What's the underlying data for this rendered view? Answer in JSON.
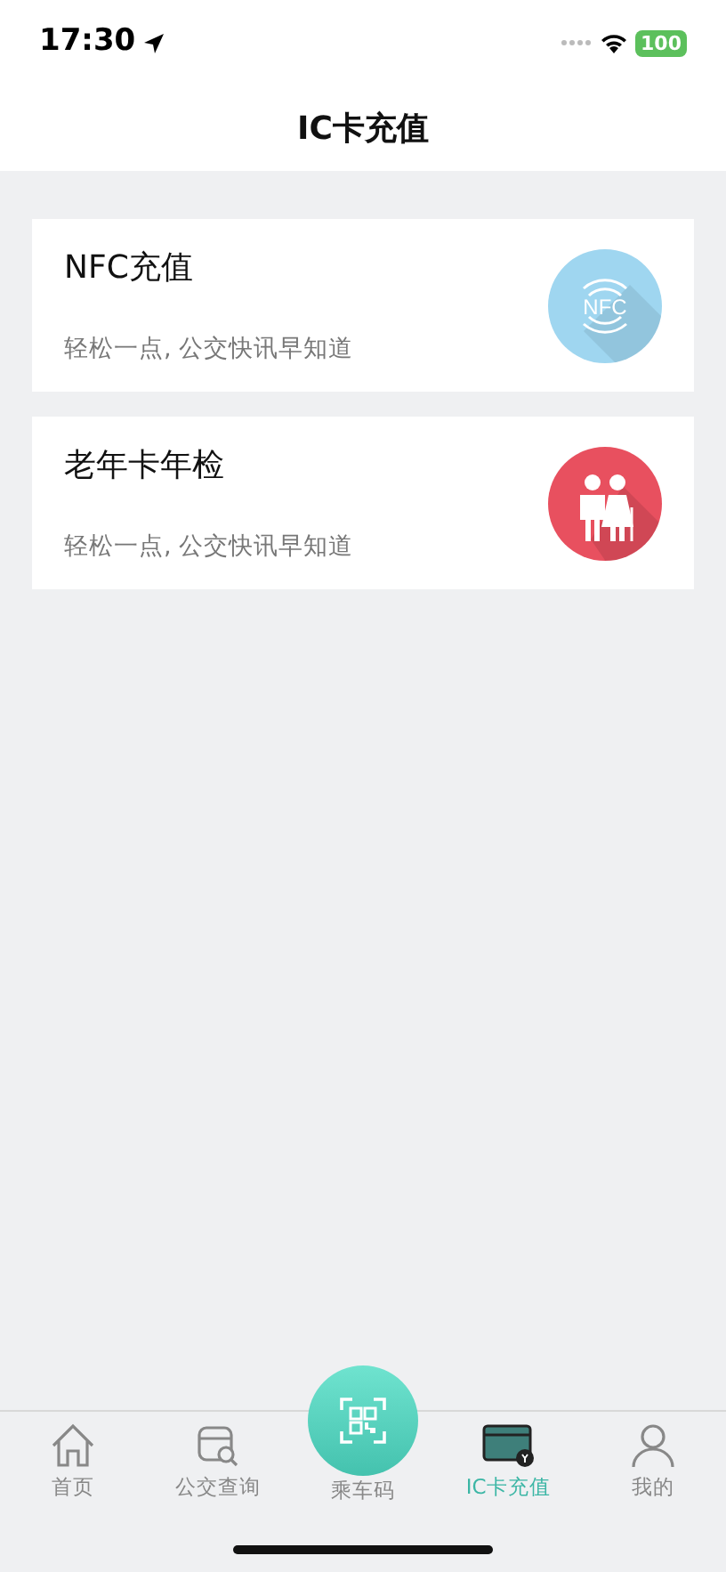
{
  "status_bar": {
    "time": "17:30",
    "battery": "100"
  },
  "header": {
    "title": "IC卡充值"
  },
  "cards": [
    {
      "kind": "nfc",
      "title": "NFC充值",
      "subtitle": "轻松一点, 公交快讯早知道",
      "color": "#9fd6f0",
      "icon_text": "NFC"
    },
    {
      "kind": "seniors",
      "title": "老年卡年检",
      "subtitle": "轻松一点, 公交快讯早知道",
      "color": "#e8505f"
    }
  ],
  "tab_bar": [
    {
      "kind": "plain",
      "label": "首页",
      "selected": false
    },
    {
      "kind": "plain",
      "label": "公交查询",
      "selected": false
    },
    {
      "kind": "raised",
      "label": "乘车码",
      "selected": false
    },
    {
      "kind": "plain",
      "label": "IC卡充值",
      "selected": true
    },
    {
      "kind": "plain",
      "label": "我的",
      "selected": false
    }
  ]
}
